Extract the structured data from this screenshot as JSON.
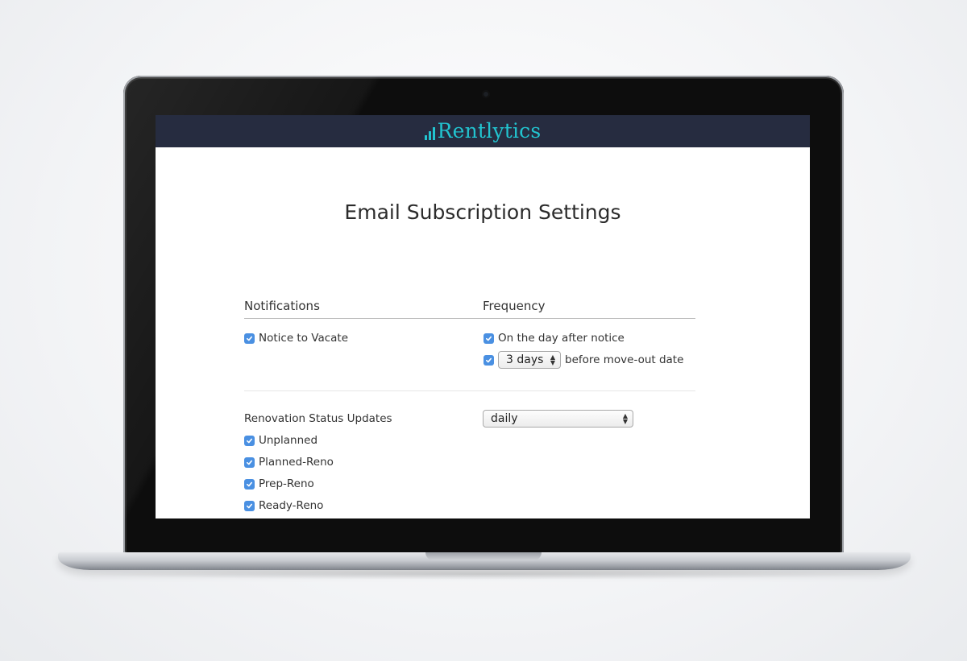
{
  "app": {
    "brand": "Rentlytics",
    "page_title": "Email Subscription Settings"
  },
  "table": {
    "headers": {
      "notifications": "Notifications",
      "frequency": "Frequency"
    }
  },
  "notice_to_vacate": {
    "label": "Notice to Vacate",
    "checked": true,
    "options": [
      {
        "label": "On the day after notice",
        "checked": true
      },
      {
        "checked": true,
        "select_value": "3 days",
        "suffix": "before move-out date"
      }
    ]
  },
  "renovation": {
    "label": "Renovation Status Updates",
    "frequency_value": "daily",
    "statuses": [
      {
        "label": "Unplanned",
        "checked": true
      },
      {
        "label": "Planned-Reno",
        "checked": true
      },
      {
        "label": "Prep-Reno",
        "checked": true
      },
      {
        "label": "Ready-Reno",
        "checked": true
      }
    ]
  },
  "colors": {
    "topbar": "#262c40",
    "brand": "#22c4d0",
    "checkbox": "#4a90e2"
  }
}
